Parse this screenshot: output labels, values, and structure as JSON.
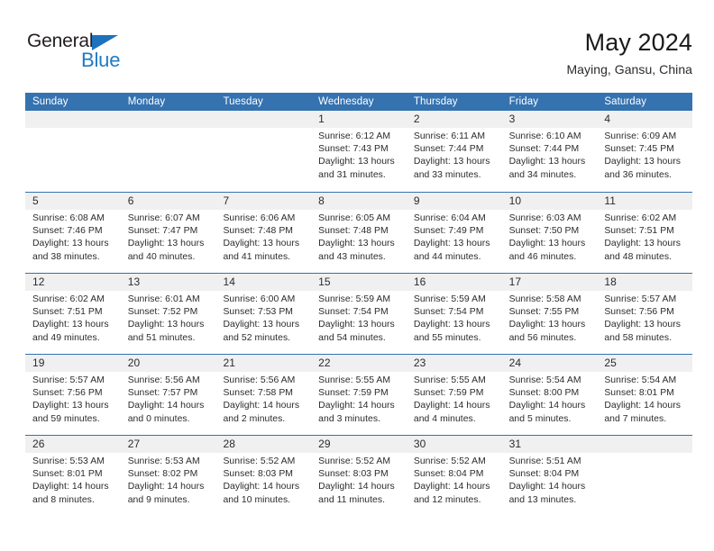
{
  "brand": {
    "name_top": "General",
    "name_bottom": "Blue",
    "triangle_color": "#1e72bd",
    "blue_text_color": "#1e7bc4"
  },
  "header": {
    "title": "May 2024",
    "subtitle": "Maying, Gansu, China"
  },
  "theme": {
    "header_blue": "#3572b0",
    "daystrip_gray": "#f0f0f0",
    "text_color": "#2b2b2b",
    "background": "#ffffff"
  },
  "weekday_headers": [
    "Sunday",
    "Monday",
    "Tuesday",
    "Wednesday",
    "Thursday",
    "Friday",
    "Saturday"
  ],
  "weeks": [
    [
      {
        "day": "",
        "sunrise": "",
        "sunset": "",
        "daylight_line1": "",
        "daylight_line2": ""
      },
      {
        "day": "",
        "sunrise": "",
        "sunset": "",
        "daylight_line1": "",
        "daylight_line2": ""
      },
      {
        "day": "",
        "sunrise": "",
        "sunset": "",
        "daylight_line1": "",
        "daylight_line2": ""
      },
      {
        "day": "1",
        "sunrise": "Sunrise: 6:12 AM",
        "sunset": "Sunset: 7:43 PM",
        "daylight_line1": "Daylight: 13 hours",
        "daylight_line2": "and 31 minutes."
      },
      {
        "day": "2",
        "sunrise": "Sunrise: 6:11 AM",
        "sunset": "Sunset: 7:44 PM",
        "daylight_line1": "Daylight: 13 hours",
        "daylight_line2": "and 33 minutes."
      },
      {
        "day": "3",
        "sunrise": "Sunrise: 6:10 AM",
        "sunset": "Sunset: 7:44 PM",
        "daylight_line1": "Daylight: 13 hours",
        "daylight_line2": "and 34 minutes."
      },
      {
        "day": "4",
        "sunrise": "Sunrise: 6:09 AM",
        "sunset": "Sunset: 7:45 PM",
        "daylight_line1": "Daylight: 13 hours",
        "daylight_line2": "and 36 minutes."
      }
    ],
    [
      {
        "day": "5",
        "sunrise": "Sunrise: 6:08 AM",
        "sunset": "Sunset: 7:46 PM",
        "daylight_line1": "Daylight: 13 hours",
        "daylight_line2": "and 38 minutes."
      },
      {
        "day": "6",
        "sunrise": "Sunrise: 6:07 AM",
        "sunset": "Sunset: 7:47 PM",
        "daylight_line1": "Daylight: 13 hours",
        "daylight_line2": "and 40 minutes."
      },
      {
        "day": "7",
        "sunrise": "Sunrise: 6:06 AM",
        "sunset": "Sunset: 7:48 PM",
        "daylight_line1": "Daylight: 13 hours",
        "daylight_line2": "and 41 minutes."
      },
      {
        "day": "8",
        "sunrise": "Sunrise: 6:05 AM",
        "sunset": "Sunset: 7:48 PM",
        "daylight_line1": "Daylight: 13 hours",
        "daylight_line2": "and 43 minutes."
      },
      {
        "day": "9",
        "sunrise": "Sunrise: 6:04 AM",
        "sunset": "Sunset: 7:49 PM",
        "daylight_line1": "Daylight: 13 hours",
        "daylight_line2": "and 44 minutes."
      },
      {
        "day": "10",
        "sunrise": "Sunrise: 6:03 AM",
        "sunset": "Sunset: 7:50 PM",
        "daylight_line1": "Daylight: 13 hours",
        "daylight_line2": "and 46 minutes."
      },
      {
        "day": "11",
        "sunrise": "Sunrise: 6:02 AM",
        "sunset": "Sunset: 7:51 PM",
        "daylight_line1": "Daylight: 13 hours",
        "daylight_line2": "and 48 minutes."
      }
    ],
    [
      {
        "day": "12",
        "sunrise": "Sunrise: 6:02 AM",
        "sunset": "Sunset: 7:51 PM",
        "daylight_line1": "Daylight: 13 hours",
        "daylight_line2": "and 49 minutes."
      },
      {
        "day": "13",
        "sunrise": "Sunrise: 6:01 AM",
        "sunset": "Sunset: 7:52 PM",
        "daylight_line1": "Daylight: 13 hours",
        "daylight_line2": "and 51 minutes."
      },
      {
        "day": "14",
        "sunrise": "Sunrise: 6:00 AM",
        "sunset": "Sunset: 7:53 PM",
        "daylight_line1": "Daylight: 13 hours",
        "daylight_line2": "and 52 minutes."
      },
      {
        "day": "15",
        "sunrise": "Sunrise: 5:59 AM",
        "sunset": "Sunset: 7:54 PM",
        "daylight_line1": "Daylight: 13 hours",
        "daylight_line2": "and 54 minutes."
      },
      {
        "day": "16",
        "sunrise": "Sunrise: 5:59 AM",
        "sunset": "Sunset: 7:54 PM",
        "daylight_line1": "Daylight: 13 hours",
        "daylight_line2": "and 55 minutes."
      },
      {
        "day": "17",
        "sunrise": "Sunrise: 5:58 AM",
        "sunset": "Sunset: 7:55 PM",
        "daylight_line1": "Daylight: 13 hours",
        "daylight_line2": "and 56 minutes."
      },
      {
        "day": "18",
        "sunrise": "Sunrise: 5:57 AM",
        "sunset": "Sunset: 7:56 PM",
        "daylight_line1": "Daylight: 13 hours",
        "daylight_line2": "and 58 minutes."
      }
    ],
    [
      {
        "day": "19",
        "sunrise": "Sunrise: 5:57 AM",
        "sunset": "Sunset: 7:56 PM",
        "daylight_line1": "Daylight: 13 hours",
        "daylight_line2": "and 59 minutes."
      },
      {
        "day": "20",
        "sunrise": "Sunrise: 5:56 AM",
        "sunset": "Sunset: 7:57 PM",
        "daylight_line1": "Daylight: 14 hours",
        "daylight_line2": "and 0 minutes."
      },
      {
        "day": "21",
        "sunrise": "Sunrise: 5:56 AM",
        "sunset": "Sunset: 7:58 PM",
        "daylight_line1": "Daylight: 14 hours",
        "daylight_line2": "and 2 minutes."
      },
      {
        "day": "22",
        "sunrise": "Sunrise: 5:55 AM",
        "sunset": "Sunset: 7:59 PM",
        "daylight_line1": "Daylight: 14 hours",
        "daylight_line2": "and 3 minutes."
      },
      {
        "day": "23",
        "sunrise": "Sunrise: 5:55 AM",
        "sunset": "Sunset: 7:59 PM",
        "daylight_line1": "Daylight: 14 hours",
        "daylight_line2": "and 4 minutes."
      },
      {
        "day": "24",
        "sunrise": "Sunrise: 5:54 AM",
        "sunset": "Sunset: 8:00 PM",
        "daylight_line1": "Daylight: 14 hours",
        "daylight_line2": "and 5 minutes."
      },
      {
        "day": "25",
        "sunrise": "Sunrise: 5:54 AM",
        "sunset": "Sunset: 8:01 PM",
        "daylight_line1": "Daylight: 14 hours",
        "daylight_line2": "and 7 minutes."
      }
    ],
    [
      {
        "day": "26",
        "sunrise": "Sunrise: 5:53 AM",
        "sunset": "Sunset: 8:01 PM",
        "daylight_line1": "Daylight: 14 hours",
        "daylight_line2": "and 8 minutes."
      },
      {
        "day": "27",
        "sunrise": "Sunrise: 5:53 AM",
        "sunset": "Sunset: 8:02 PM",
        "daylight_line1": "Daylight: 14 hours",
        "daylight_line2": "and 9 minutes."
      },
      {
        "day": "28",
        "sunrise": "Sunrise: 5:52 AM",
        "sunset": "Sunset: 8:03 PM",
        "daylight_line1": "Daylight: 14 hours",
        "daylight_line2": "and 10 minutes."
      },
      {
        "day": "29",
        "sunrise": "Sunrise: 5:52 AM",
        "sunset": "Sunset: 8:03 PM",
        "daylight_line1": "Daylight: 14 hours",
        "daylight_line2": "and 11 minutes."
      },
      {
        "day": "30",
        "sunrise": "Sunrise: 5:52 AM",
        "sunset": "Sunset: 8:04 PM",
        "daylight_line1": "Daylight: 14 hours",
        "daylight_line2": "and 12 minutes."
      },
      {
        "day": "31",
        "sunrise": "Sunrise: 5:51 AM",
        "sunset": "Sunset: 8:04 PM",
        "daylight_line1": "Daylight: 14 hours",
        "daylight_line2": "and 13 minutes."
      },
      {
        "day": "",
        "sunrise": "",
        "sunset": "",
        "daylight_line1": "",
        "daylight_line2": ""
      }
    ]
  ]
}
